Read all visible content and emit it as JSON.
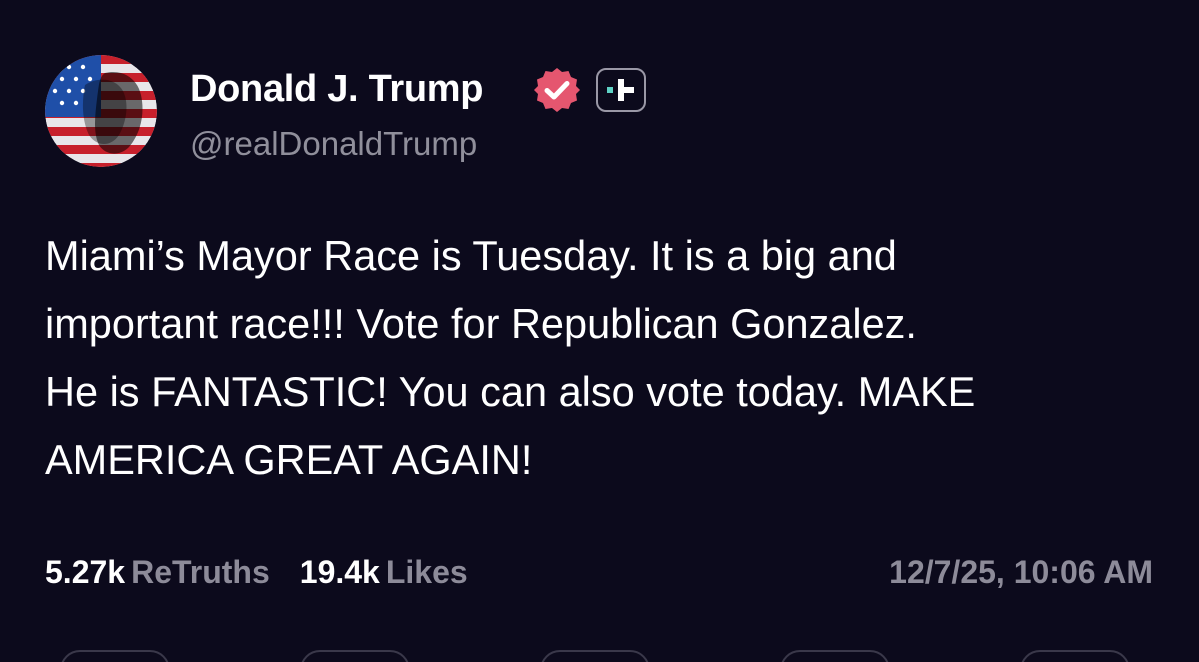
{
  "post": {
    "author": {
      "display_name": "Donald J. Trump",
      "handle": "@realDonaldTrump",
      "verified": true,
      "avatar_icon": "avatar-flag-portrait",
      "verified_icon": "verified-badge-icon",
      "plus_icon": "plus-subscription-icon"
    },
    "body_lines": [
      "Miami’s Mayor Race is Tuesday. It is a big and",
      "important race!!! Vote for Republican Gonzalez.",
      "He is FANTASTIC! You can also vote today. MAKE",
      "AMERICA GREAT AGAIN!"
    ],
    "stats": {
      "retruths_count": "5.27k",
      "retruths_label": "ReTruths",
      "likes_count": "19.4k",
      "likes_label": "Likes"
    },
    "timestamp": "12/7/25, 10:06 AM"
  },
  "colors": {
    "background": "#0c0a1c",
    "text_primary": "#ffffff",
    "text_secondary": "#8d8b99",
    "verified_badge": "#e5566f",
    "plus_accent": "#5fd3c6"
  }
}
